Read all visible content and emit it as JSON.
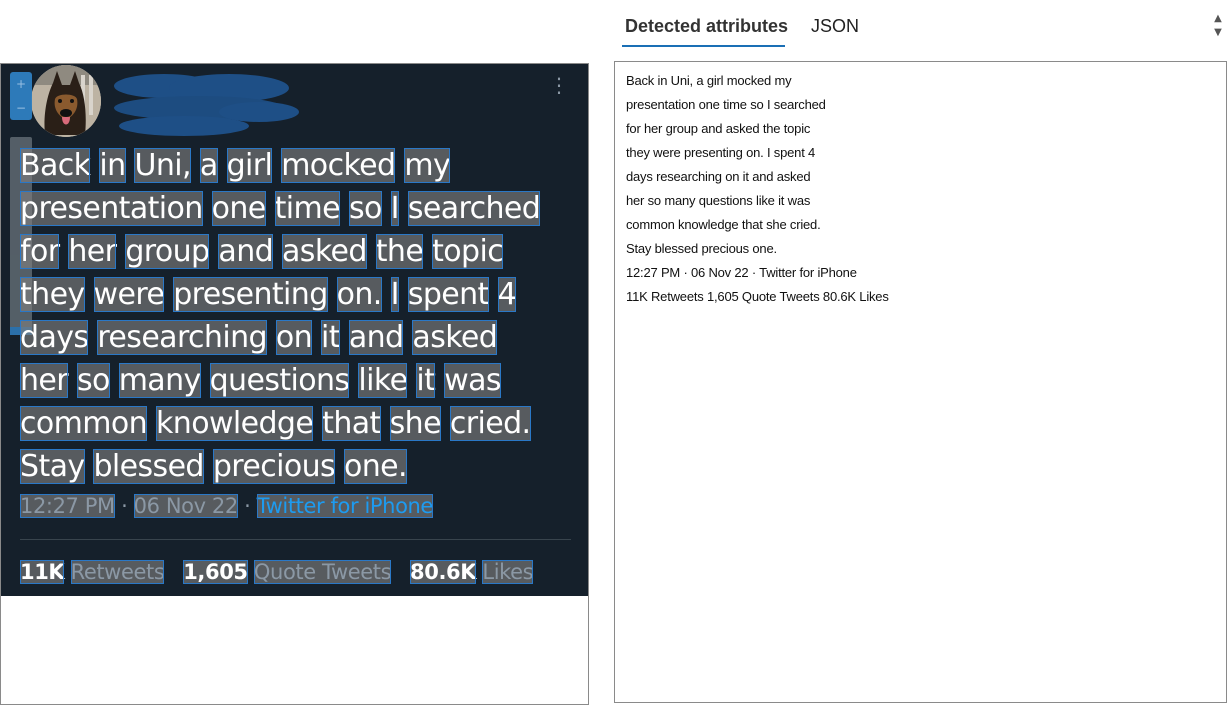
{
  "tabs": {
    "detected_attributes": "Detected attributes",
    "json": "JSON"
  },
  "tweet": {
    "words": [
      [
        "Back",
        "in",
        "Uni,",
        "a",
        "girl",
        "mocked",
        "my"
      ],
      [
        "presentation",
        "one",
        "time",
        "so",
        "I",
        "searched"
      ],
      [
        "for",
        "her",
        "group",
        "and",
        "asked",
        "the",
        "topic"
      ],
      [
        "they",
        "were",
        "presenting",
        "on.",
        "I",
        "spent",
        "4"
      ],
      [
        "days",
        "researching",
        "on",
        "it",
        "and",
        "asked"
      ],
      [
        "her",
        "so",
        "many",
        "questions",
        "like",
        "it",
        "was"
      ],
      [
        "common",
        "knowledge",
        "that",
        "she",
        "cried."
      ],
      [
        "Stay",
        "blessed",
        "precious",
        "one."
      ]
    ],
    "time": "12:27 PM",
    "date": "06 Nov 22",
    "source": "Twitter for iPhone",
    "separator": "·",
    "retweets_count": "11K",
    "retweets_label": "Retweets",
    "quotes_count": "1,605",
    "quotes_label": "Quote Tweets",
    "likes_count": "80.6K",
    "likes_label": "Likes"
  },
  "output_lines": [
    "Back in Uni, a girl mocked my",
    "presentation one time so I searched",
    "for her group and asked the topic",
    "they were presenting on. I spent 4",
    "days researching on it and asked",
    "her so many questions like it was",
    "common knowledge that she cried.",
    "Stay blessed precious one.",
    "12:27 PM · 06 Nov 22 · Twitter for iPhone",
    "11K Retweets 1,605 Quote Tweets 80.6K Likes"
  ],
  "colors": {
    "tweet_bg": "#15202b",
    "accent": "#1a6fb5",
    "link": "#1d9bf0",
    "muted": "#8b98a5"
  },
  "icons": [
    "more-vertical-icon",
    "zoom-in-icon",
    "zoom-out-icon",
    "scroll-up-icon",
    "scroll-down-icon"
  ]
}
